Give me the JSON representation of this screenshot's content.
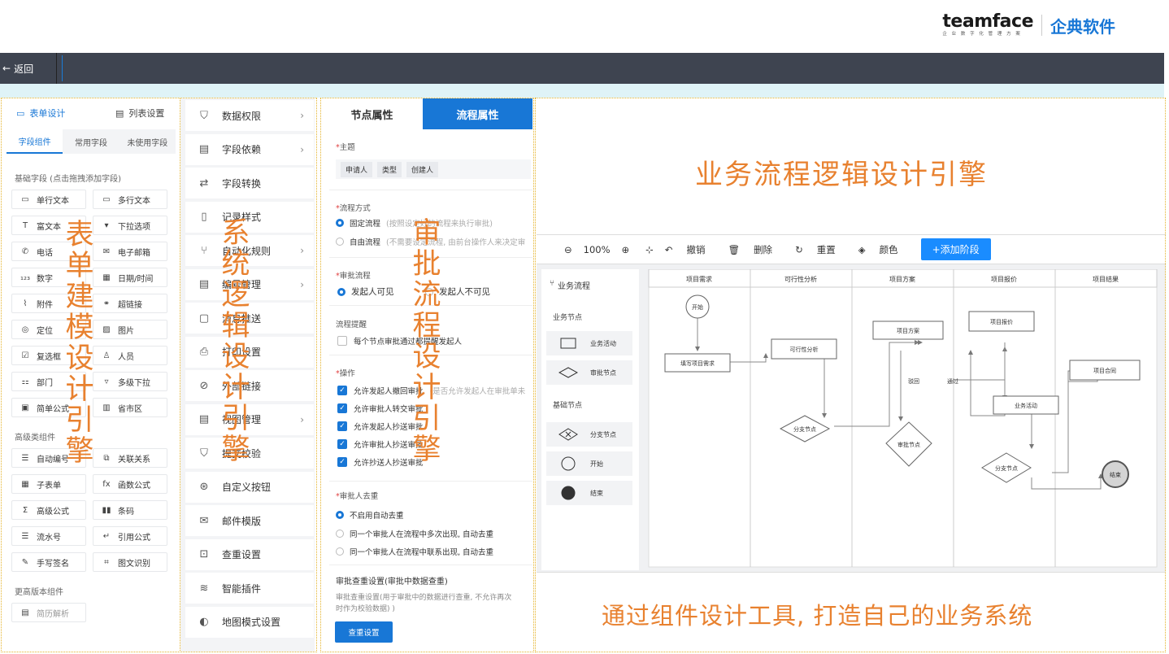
{
  "brand": {
    "name_en": "teamface",
    "tagline": "企 业 数 字 化 管 理 方 案",
    "name_cn": "企典软件"
  },
  "nav": {
    "back_label": "返回"
  },
  "form_panel": {
    "tab_design": "表单设计",
    "tab_list": "列表设置",
    "sub_tabs": [
      "字段组件",
      "常用字段",
      "未使用字段"
    ],
    "basic_section": "基础字段 (点击拖拽添加字段)",
    "basic_fields": [
      {
        "label": "单行文本",
        "icon": "single-line-icon"
      },
      {
        "label": "多行文本",
        "icon": "multi-line-icon"
      },
      {
        "label": "富文本",
        "icon": "rich-text-icon"
      },
      {
        "label": "下拉选项",
        "icon": "dropdown-icon"
      },
      {
        "label": "电话",
        "icon": "phone-icon"
      },
      {
        "label": "电子邮箱",
        "icon": "email-icon"
      },
      {
        "label": "数字",
        "icon": "number-icon"
      },
      {
        "label": "日期/时间",
        "icon": "calendar-icon"
      },
      {
        "label": "附件",
        "icon": "attachment-icon"
      },
      {
        "label": "超链接",
        "icon": "link-icon"
      },
      {
        "label": "定位",
        "icon": "location-icon"
      },
      {
        "label": "图片",
        "icon": "image-icon"
      },
      {
        "label": "复选框",
        "icon": "checkbox-icon"
      },
      {
        "label": "人员",
        "icon": "person-icon"
      },
      {
        "label": "部门",
        "icon": "department-icon"
      },
      {
        "label": "多级下拉",
        "icon": "multi-dropdown-icon"
      },
      {
        "label": "简单公式",
        "icon": "formula-icon"
      },
      {
        "label": "省市区",
        "icon": "map-icon"
      }
    ],
    "advanced_section": "高级类组件",
    "advanced_fields": [
      {
        "label": "自动编号",
        "icon": "auto-number-icon"
      },
      {
        "label": "关联关系",
        "icon": "relation-icon"
      },
      {
        "label": "子表单",
        "icon": "subform-icon"
      },
      {
        "label": "函数公式",
        "icon": "function-icon"
      },
      {
        "label": "高级公式",
        "icon": "sigma-icon"
      },
      {
        "label": "条码",
        "icon": "barcode-icon"
      },
      {
        "label": "流水号",
        "icon": "serial-icon"
      },
      {
        "label": "引用公式",
        "icon": "reference-icon"
      },
      {
        "label": "手写签名",
        "icon": "signature-icon"
      },
      {
        "label": "图文识别",
        "icon": "ocr-icon"
      }
    ],
    "premium_section": "更高版本组件",
    "premium_fields": [
      {
        "label": "简历解析",
        "icon": "resume-icon"
      }
    ],
    "overlay_text": [
      "表",
      "单",
      "建",
      "模",
      "设",
      "计",
      "引",
      "擎"
    ]
  },
  "system_panel": {
    "items": [
      {
        "label": "数据权限",
        "chevron": true
      },
      {
        "label": "字段依赖",
        "chevron": true
      },
      {
        "label": "字段转换",
        "chevron": false
      },
      {
        "label": "记录样式",
        "chevron": false
      },
      {
        "label": "自动化规则",
        "chevron": true
      },
      {
        "label": "编号管理",
        "chevron": true
      },
      {
        "label": "消息推送",
        "chevron": false
      },
      {
        "label": "打印设置",
        "chevron": false
      },
      {
        "label": "外部链接",
        "chevron": false
      },
      {
        "label": "视图管理",
        "chevron": true
      },
      {
        "label": "提交校验",
        "chevron": false
      },
      {
        "label": "自定义按钮",
        "chevron": false
      },
      {
        "label": "邮件模版",
        "chevron": false
      },
      {
        "label": "查重设置",
        "chevron": false
      },
      {
        "label": "智能插件",
        "chevron": false
      },
      {
        "label": "地图模式设置",
        "chevron": false
      }
    ],
    "overlay_text": [
      "系",
      "统",
      "逻",
      "辑",
      "设",
      "计",
      "引",
      "擎"
    ]
  },
  "approval_panel": {
    "tab_node": "节点属性",
    "tab_flow": "流程属性",
    "subject_label": "主题",
    "subject_tags": [
      "申请人",
      "类型",
      "创建人"
    ],
    "mode_label": "流程方式",
    "mode_fixed": "固定流程",
    "mode_fixed_hint": "(按照设定好的流程来执行审批)",
    "mode_free": "自由流程",
    "mode_free_hint": "(不需要设定流程, 由前台操作人来决定审",
    "approval_label": "审批流程",
    "vis_yes": "发起人可见",
    "vis_no": "发起人不可见",
    "remind_label": "流程提醒",
    "remind_option": "每个节点审批通过都提醒发起人",
    "ops_label": "操作",
    "ops": [
      {
        "label": "允许发起人撤回审批",
        "hint": "(是否允许发起人在审批单未"
      },
      {
        "label": "允许审批人转交审批",
        "hint": ""
      },
      {
        "label": "允许发起人抄送审批",
        "hint": ""
      },
      {
        "label": "允许审批人抄送审批",
        "hint": ""
      },
      {
        "label": "允许抄送人抄送审批",
        "hint": ""
      }
    ],
    "dedupe_label": "审批人去重",
    "dedupe_options": [
      "不启用自动去重",
      "同一个审批人在流程中多次出现, 自动去重",
      "同一个审批人在流程中联系出现, 自动去重"
    ],
    "check_title": "审批查重设置(审批中数据查重)",
    "check_desc_1": "审批查重设置(用于审批中的数据进行查重, 不允许再次",
    "check_desc_2": "时作为校验数据) )",
    "check_button": "查重设置",
    "overlay_text": [
      "审",
      "批",
      "流",
      "程",
      "设",
      "计",
      "引",
      "擎"
    ]
  },
  "workflow": {
    "headline": "业务流程逻辑设计引擎",
    "caption": "通过组件设计工具, 打造自己的业务系统",
    "toolbar": {
      "zoom": "100%",
      "undo": "撤销",
      "delete": "删除",
      "reset": "重置",
      "color": "颜色",
      "add_stage": "+添加阶段"
    },
    "sidebar": {
      "title": "业务流程",
      "business_section": "业务节点",
      "business_items": [
        "业务活动",
        "审批节点"
      ],
      "basic_section": "基础节点",
      "basic_items": [
        "分支节点",
        "开始",
        "结束"
      ]
    },
    "lanes": [
      "项目需求",
      "可行性分析",
      "项目方案",
      "项目报价",
      "项目结果"
    ],
    "nodes": {
      "start": "开始",
      "fill": "填写项目需求",
      "feasibility": "可行性分析",
      "plan": "项目方案",
      "quote": "项目报价",
      "contract": "项目合同",
      "activity": "业务活动",
      "branch1": "分支节点",
      "approve": "审批节点",
      "branch2": "分支节点",
      "end": "结束",
      "reject": "驳回",
      "pass": "通过"
    }
  }
}
